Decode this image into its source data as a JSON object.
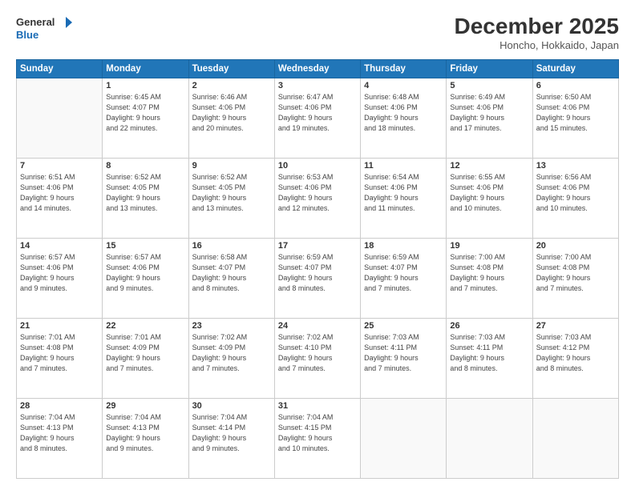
{
  "logo": {
    "line1": "General",
    "line2": "Blue"
  },
  "title": "December 2025",
  "location": "Honcho, Hokkaido, Japan",
  "days_of_week": [
    "Sunday",
    "Monday",
    "Tuesday",
    "Wednesday",
    "Thursday",
    "Friday",
    "Saturday"
  ],
  "weeks": [
    [
      {
        "day": "",
        "info": ""
      },
      {
        "day": "1",
        "info": "Sunrise: 6:45 AM\nSunset: 4:07 PM\nDaylight: 9 hours\nand 22 minutes."
      },
      {
        "day": "2",
        "info": "Sunrise: 6:46 AM\nSunset: 4:06 PM\nDaylight: 9 hours\nand 20 minutes."
      },
      {
        "day": "3",
        "info": "Sunrise: 6:47 AM\nSunset: 4:06 PM\nDaylight: 9 hours\nand 19 minutes."
      },
      {
        "day": "4",
        "info": "Sunrise: 6:48 AM\nSunset: 4:06 PM\nDaylight: 9 hours\nand 18 minutes."
      },
      {
        "day": "5",
        "info": "Sunrise: 6:49 AM\nSunset: 4:06 PM\nDaylight: 9 hours\nand 17 minutes."
      },
      {
        "day": "6",
        "info": "Sunrise: 6:50 AM\nSunset: 4:06 PM\nDaylight: 9 hours\nand 15 minutes."
      }
    ],
    [
      {
        "day": "7",
        "info": "Sunrise: 6:51 AM\nSunset: 4:06 PM\nDaylight: 9 hours\nand 14 minutes."
      },
      {
        "day": "8",
        "info": "Sunrise: 6:52 AM\nSunset: 4:05 PM\nDaylight: 9 hours\nand 13 minutes."
      },
      {
        "day": "9",
        "info": "Sunrise: 6:52 AM\nSunset: 4:05 PM\nDaylight: 9 hours\nand 13 minutes."
      },
      {
        "day": "10",
        "info": "Sunrise: 6:53 AM\nSunset: 4:06 PM\nDaylight: 9 hours\nand 12 minutes."
      },
      {
        "day": "11",
        "info": "Sunrise: 6:54 AM\nSunset: 4:06 PM\nDaylight: 9 hours\nand 11 minutes."
      },
      {
        "day": "12",
        "info": "Sunrise: 6:55 AM\nSunset: 4:06 PM\nDaylight: 9 hours\nand 10 minutes."
      },
      {
        "day": "13",
        "info": "Sunrise: 6:56 AM\nSunset: 4:06 PM\nDaylight: 9 hours\nand 10 minutes."
      }
    ],
    [
      {
        "day": "14",
        "info": "Sunrise: 6:57 AM\nSunset: 4:06 PM\nDaylight: 9 hours\nand 9 minutes."
      },
      {
        "day": "15",
        "info": "Sunrise: 6:57 AM\nSunset: 4:06 PM\nDaylight: 9 hours\nand 9 minutes."
      },
      {
        "day": "16",
        "info": "Sunrise: 6:58 AM\nSunset: 4:07 PM\nDaylight: 9 hours\nand 8 minutes."
      },
      {
        "day": "17",
        "info": "Sunrise: 6:59 AM\nSunset: 4:07 PM\nDaylight: 9 hours\nand 8 minutes."
      },
      {
        "day": "18",
        "info": "Sunrise: 6:59 AM\nSunset: 4:07 PM\nDaylight: 9 hours\nand 7 minutes."
      },
      {
        "day": "19",
        "info": "Sunrise: 7:00 AM\nSunset: 4:08 PM\nDaylight: 9 hours\nand 7 minutes."
      },
      {
        "day": "20",
        "info": "Sunrise: 7:00 AM\nSunset: 4:08 PM\nDaylight: 9 hours\nand 7 minutes."
      }
    ],
    [
      {
        "day": "21",
        "info": "Sunrise: 7:01 AM\nSunset: 4:08 PM\nDaylight: 9 hours\nand 7 minutes."
      },
      {
        "day": "22",
        "info": "Sunrise: 7:01 AM\nSunset: 4:09 PM\nDaylight: 9 hours\nand 7 minutes."
      },
      {
        "day": "23",
        "info": "Sunrise: 7:02 AM\nSunset: 4:09 PM\nDaylight: 9 hours\nand 7 minutes."
      },
      {
        "day": "24",
        "info": "Sunrise: 7:02 AM\nSunset: 4:10 PM\nDaylight: 9 hours\nand 7 minutes."
      },
      {
        "day": "25",
        "info": "Sunrise: 7:03 AM\nSunset: 4:11 PM\nDaylight: 9 hours\nand 7 minutes."
      },
      {
        "day": "26",
        "info": "Sunrise: 7:03 AM\nSunset: 4:11 PM\nDaylight: 9 hours\nand 8 minutes."
      },
      {
        "day": "27",
        "info": "Sunrise: 7:03 AM\nSunset: 4:12 PM\nDaylight: 9 hours\nand 8 minutes."
      }
    ],
    [
      {
        "day": "28",
        "info": "Sunrise: 7:04 AM\nSunset: 4:13 PM\nDaylight: 9 hours\nand 8 minutes."
      },
      {
        "day": "29",
        "info": "Sunrise: 7:04 AM\nSunset: 4:13 PM\nDaylight: 9 hours\nand 9 minutes."
      },
      {
        "day": "30",
        "info": "Sunrise: 7:04 AM\nSunset: 4:14 PM\nDaylight: 9 hours\nand 9 minutes."
      },
      {
        "day": "31",
        "info": "Sunrise: 7:04 AM\nSunset: 4:15 PM\nDaylight: 9 hours\nand 10 minutes."
      },
      {
        "day": "",
        "info": ""
      },
      {
        "day": "",
        "info": ""
      },
      {
        "day": "",
        "info": ""
      }
    ]
  ]
}
